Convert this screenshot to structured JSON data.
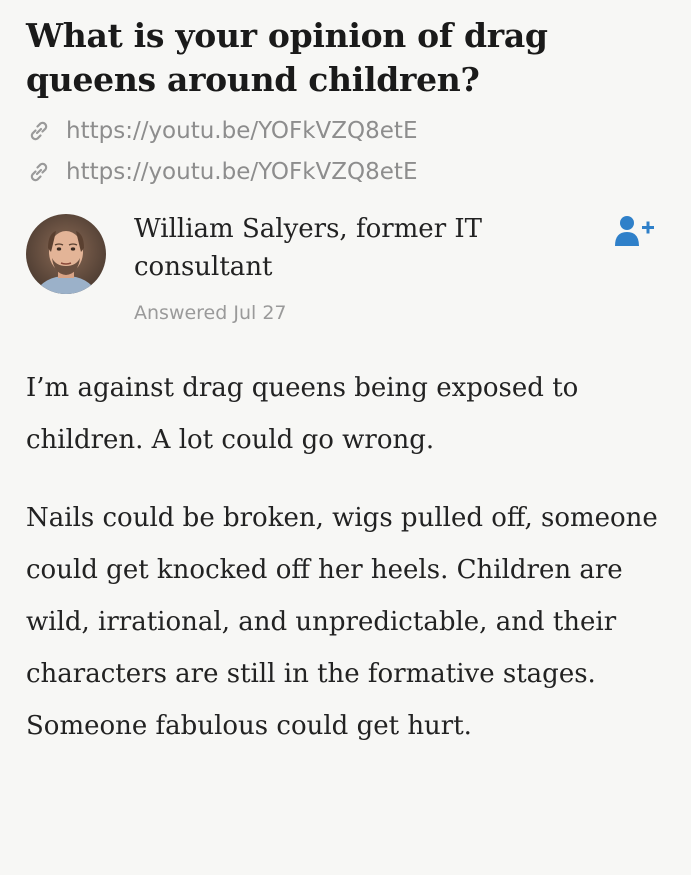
{
  "question": {
    "title": "What is your opinion of drag queens around children?"
  },
  "links": [
    {
      "text": "https://youtu.be/YOFkVZQ8etE",
      "icon": "link-icon"
    },
    {
      "text": "https://youtu.be/YOFkVZQ8etE",
      "icon": "link-icon"
    }
  ],
  "answer": {
    "author_name": "William Salyers, former IT consultant",
    "answered_date": "Answered Jul 27",
    "follow_icon": "follow-user-icon",
    "avatar_icon": "avatar",
    "paragraphs": [
      "I’m against drag queens being exposed to children. A lot could go wrong.",
      "Nails could be broken, wigs pulled off, someone could get knocked off her heels. Children are wild, irrational, and unpredictable, and their characters are still in the formative stages. Someone fabulous could get hurt."
    ]
  },
  "colors": {
    "background": "#f7f7f5",
    "text": "#222222",
    "muted": "#8d8d8d",
    "accent_blue": "#2f80c9"
  }
}
